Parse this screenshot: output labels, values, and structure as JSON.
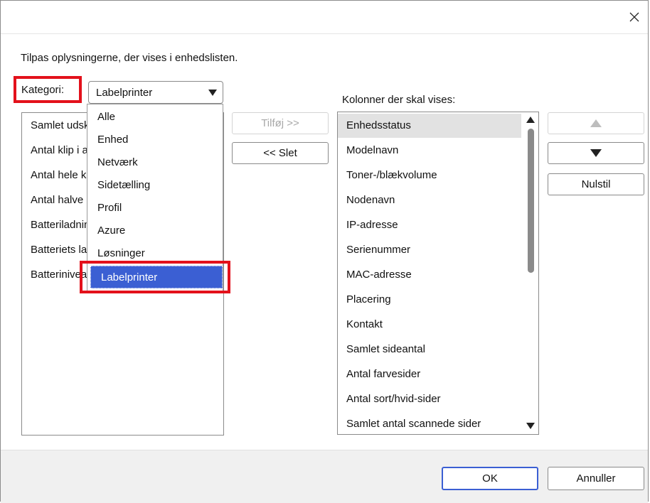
{
  "instruction": "Tilpas oplysningerne, der vises i enhedslisten.",
  "category": {
    "label": "Kategori:",
    "selected": "Labelprinter",
    "options": [
      "Alle",
      "Enhed",
      "Netværk",
      "Sidetælling",
      "Profil",
      "Azure",
      "Løsninger",
      "Labelprinter"
    ]
  },
  "available_list": {
    "items": [
      "Samlet udskrevet længde",
      "Antal klip i alt",
      "Antal hele klip",
      "Antal halve klip",
      "Batteriladning",
      "Batteriets lademodus",
      "Batteriniveau"
    ]
  },
  "buttons": {
    "add": "Tilføj >>",
    "remove": "<< Slet",
    "reset": "Nulstil",
    "ok": "OK",
    "cancel": "Annuller"
  },
  "shown_columns": {
    "header": "Kolonner der skal vises:",
    "items": [
      "Enhedsstatus",
      "Modelnavn",
      "Toner-/blækvolume",
      "Nodenavn",
      "IP-adresse",
      "Serienummer",
      "MAC-adresse",
      "Placering",
      "Kontakt",
      "Samlet sideantal",
      "Antal farvesider",
      "Antal sort/hvid-sider",
      "Samlet antal scannede sider"
    ],
    "selected_index": 0
  },
  "icons": {
    "close": "close-icon",
    "combo_arrow": "chevron-down-icon",
    "move_up": "triangle-up-icon",
    "move_down": "triangle-down-icon"
  },
  "colors": {
    "highlight": "#e3111b",
    "selection": "#3b5fd3"
  }
}
